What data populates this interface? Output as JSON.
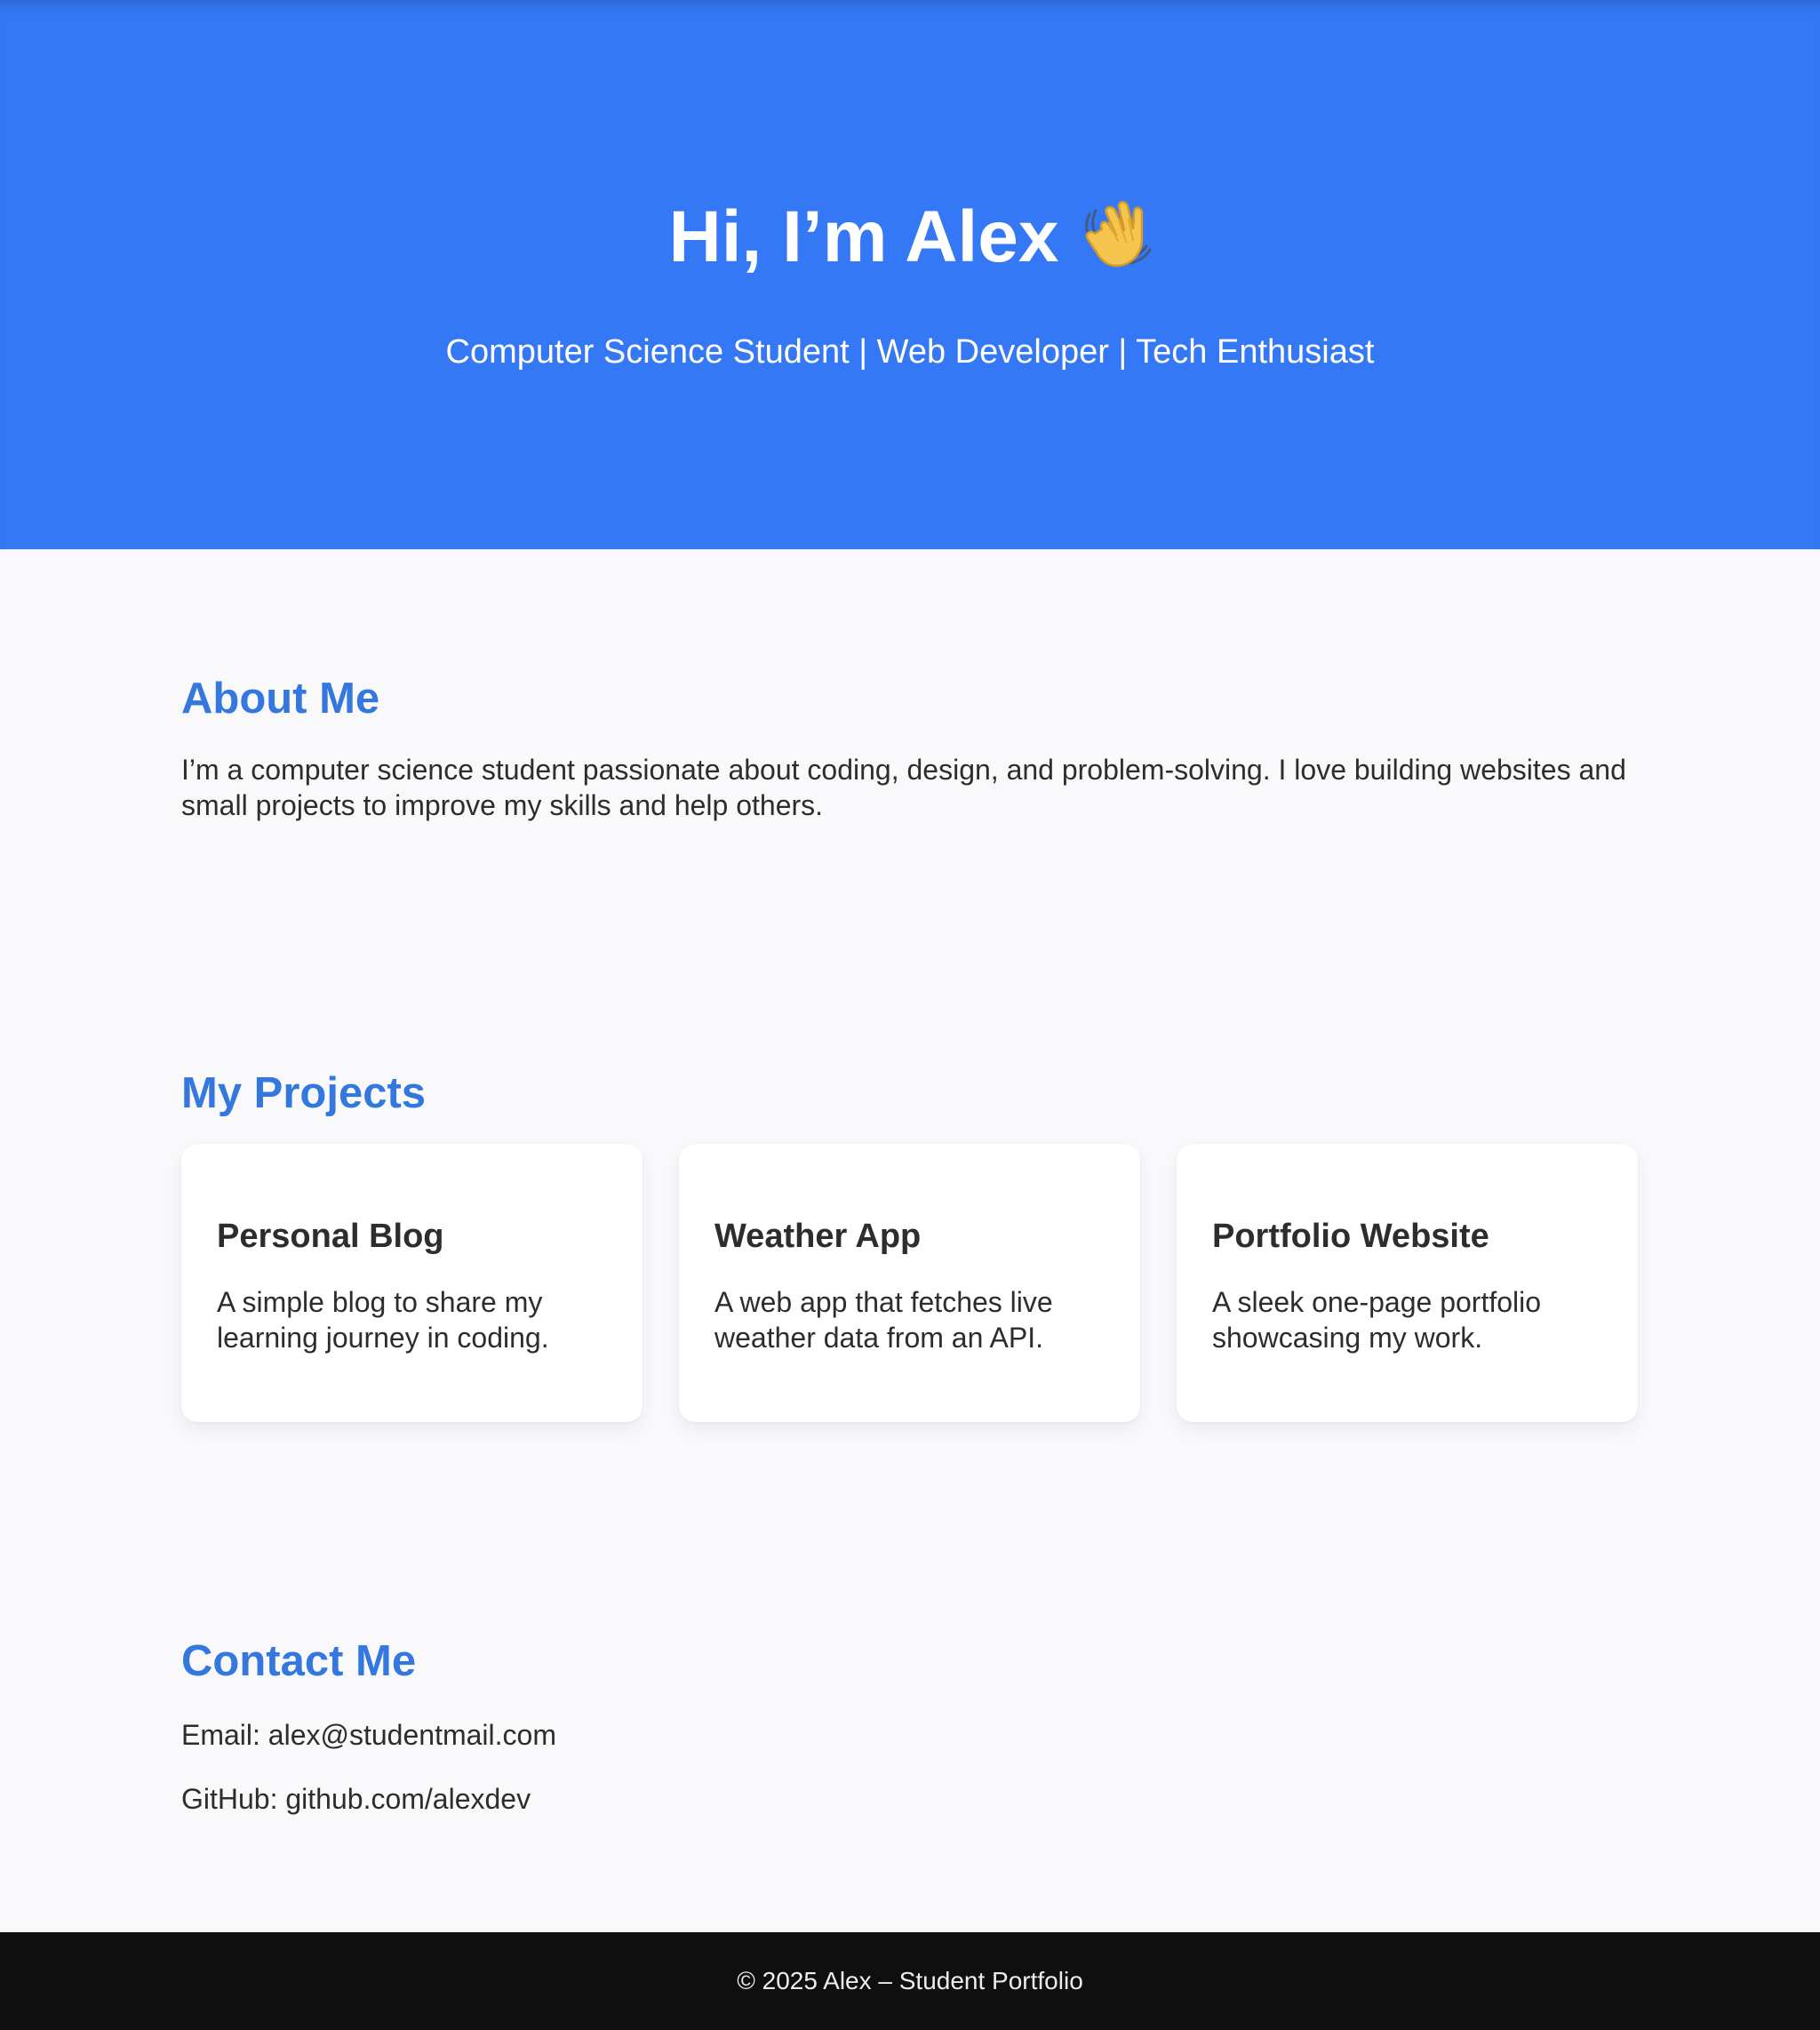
{
  "hero": {
    "title": "Hi, I’m Alex",
    "icon": "waving-hand-icon",
    "subtitle": "Computer Science Student | Web Developer | Tech Enthusiast"
  },
  "about": {
    "title": "About Me",
    "text": "I’m a computer science student passionate about coding, design, and problem-solving. I love building websites and small projects to improve my skills and help others."
  },
  "projects": {
    "title": "My Projects",
    "items": [
      {
        "title": "Personal Blog",
        "description": "A simple blog to share my learning journey in coding."
      },
      {
        "title": "Weather App",
        "description": "A web app that fetches live weather data from an API."
      },
      {
        "title": "Portfolio Website",
        "description": "A sleek one-page portfolio showcasing my work."
      }
    ]
  },
  "contact": {
    "title": "Contact Me",
    "email": "Email: alex@studentmail.com",
    "github": "GitHub: github.com/alexdev"
  },
  "footer": {
    "text": "© 2025 Alex – Student Portfolio"
  },
  "colors": {
    "hero_background": "#3478f6",
    "section_title": "#3478df",
    "page_background": "#f9f9fc",
    "footer_background": "#0f0f0f"
  }
}
